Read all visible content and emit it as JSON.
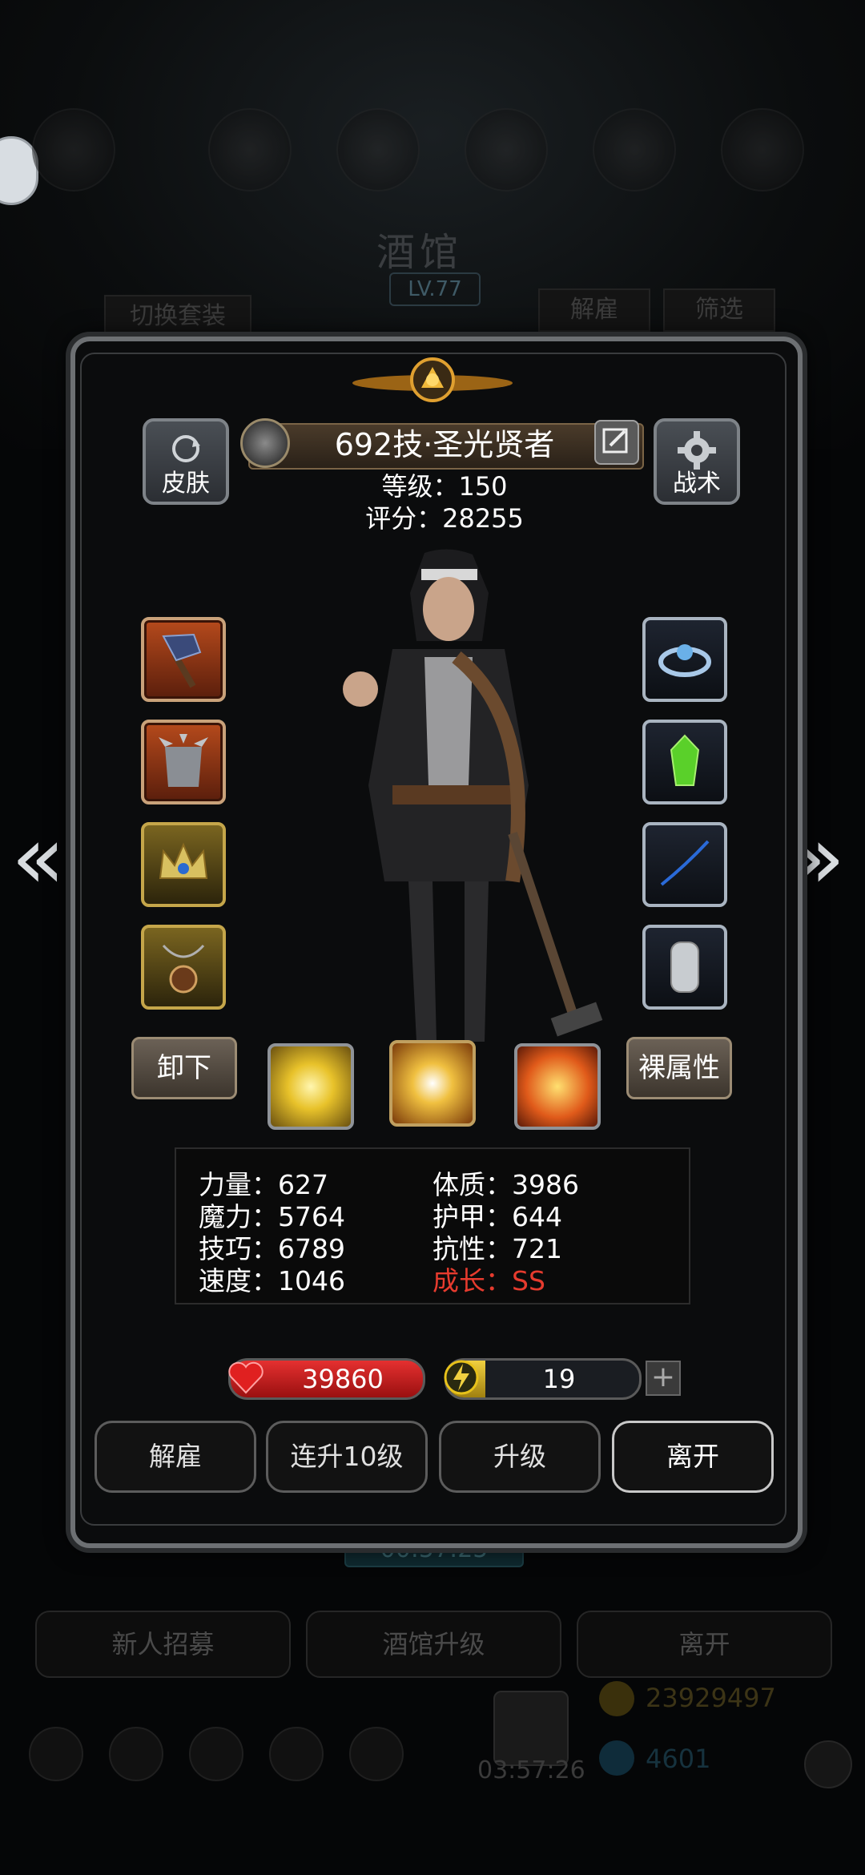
{
  "background": {
    "title": "酒馆",
    "level": "LV.77",
    "switch_outfit": "切换套装",
    "dismiss": "解雇",
    "filter": "筛选",
    "timer": "00:57:25",
    "bottom_buttons": [
      "新人招募",
      "酒馆升级",
      "离开"
    ],
    "gold": "23929497",
    "gems": "4601",
    "chest_timer": "03:57:26"
  },
  "hero": {
    "skin_label": "皮肤",
    "tactics_label": "战术",
    "name": "692技·圣光贤者",
    "level_text": "等级：150",
    "score_text": "评分：28255"
  },
  "equipment": {
    "left": [
      {
        "icon": "axe-icon",
        "rarity": "red"
      },
      {
        "icon": "spiked-armor-icon",
        "rarity": "red"
      },
      {
        "icon": "crown-icon",
        "rarity": "gold"
      },
      {
        "icon": "amulet-icon",
        "rarity": "gold"
      }
    ],
    "right": [
      {
        "icon": "ring-icon",
        "rarity": "blue"
      },
      {
        "icon": "green-gem-icon",
        "rarity": "blue"
      },
      {
        "icon": "blue-feather-icon",
        "rarity": "blue"
      },
      {
        "icon": "chainmail-glove-icon",
        "rarity": "blue"
      }
    ]
  },
  "actions": {
    "unequip": "卸下",
    "naked_attributes": "裸属性"
  },
  "skills": [
    "holy-burst-icon",
    "light-orb-icon",
    "holy-shield-icon"
  ],
  "stats": {
    "strength": "力量：627",
    "magic": "魔力：5764",
    "skill": "技巧：6789",
    "speed": "速度：1046",
    "constitution": "体质：3986",
    "armor": "护甲：644",
    "resistance": "抗性：721",
    "growth": "成长：SS"
  },
  "bars": {
    "hp": "39860",
    "energy": "19",
    "energy_fill_pct": 20,
    "plus": "+"
  },
  "panel_buttons": [
    "解雇",
    "连升10级",
    "升级",
    "离开"
  ],
  "colors": {
    "growth": "#e63b2e",
    "hp": "#e53030",
    "energy": "#e8c21a"
  }
}
